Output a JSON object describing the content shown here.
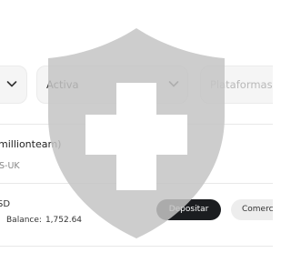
{
  "filters": [
    {
      "value": ""
    },
    {
      "value": "Activa"
    },
    {
      "placeholder": "Plataformas d"
    }
  ],
  "account": {
    "name": "millionteam)",
    "server": "S-UK",
    "currency": "SD",
    "balance_label": "Balance:",
    "balance_value": "1,752.64"
  },
  "actions": {
    "deposit_label": "Depositar",
    "trade_label": "Comerci"
  },
  "colors": {
    "overlay_shield": "#c4c4c4",
    "overlay_cross": "#ffffff",
    "deposit_button_bg": "#1b1d20",
    "trade_button_bg": "#ededed"
  },
  "overlay_icon": "shield-cross-icon"
}
